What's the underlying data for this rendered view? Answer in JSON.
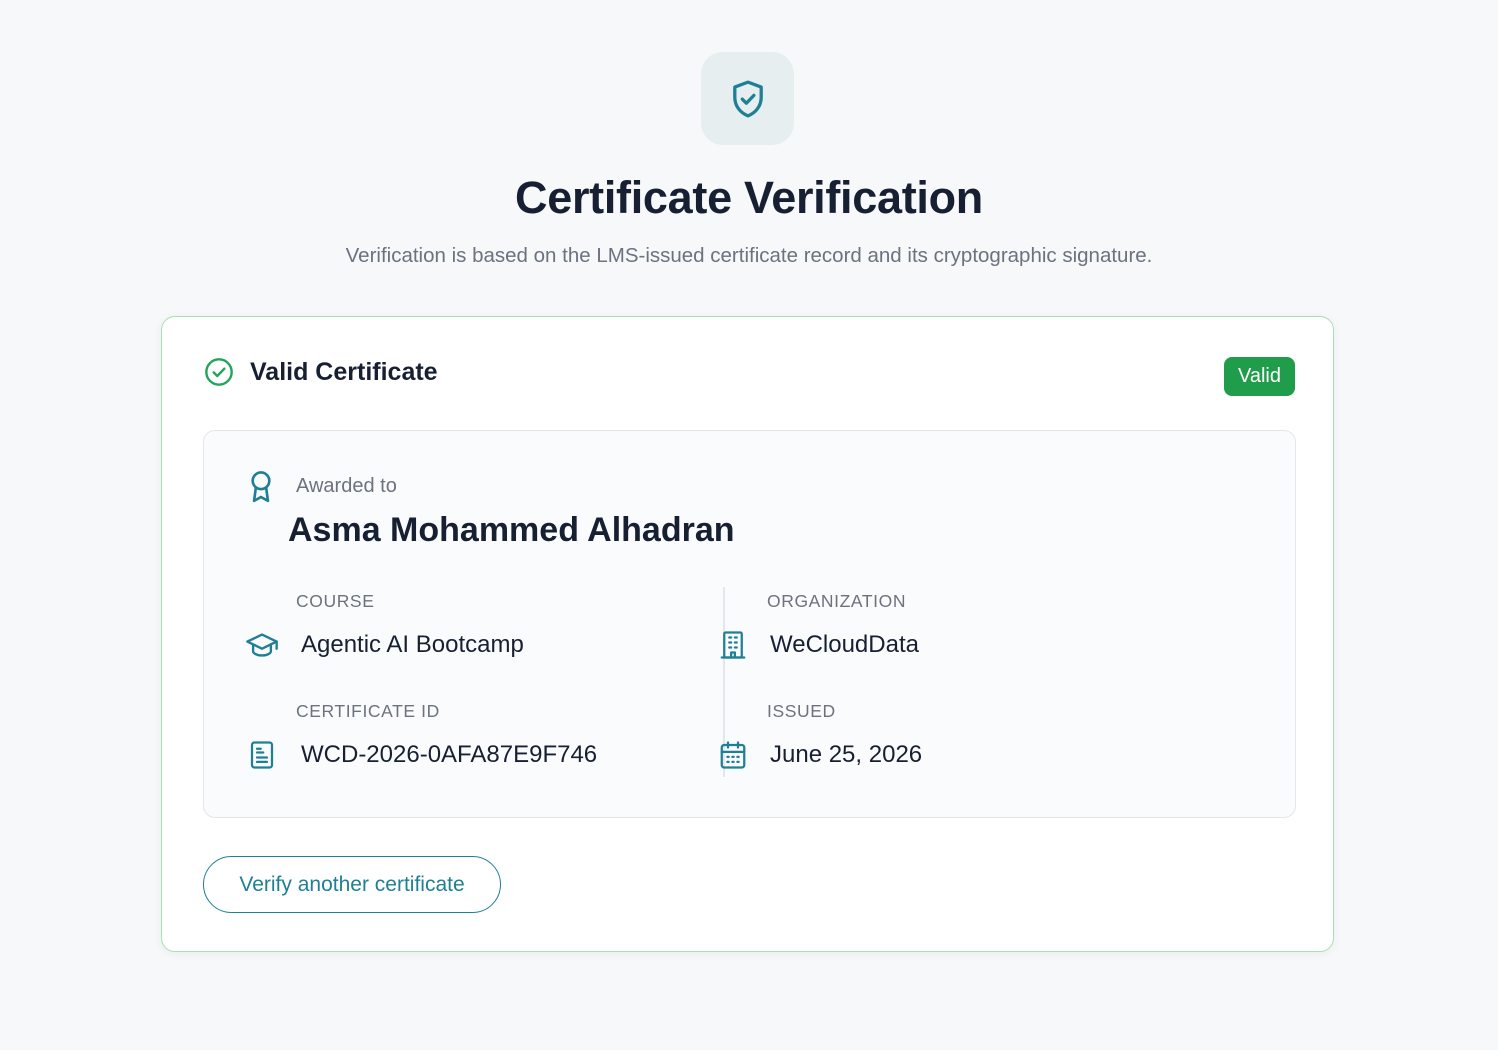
{
  "header": {
    "icon": "shield-check-icon",
    "title": "Certificate Verification",
    "subtitle": "Verification is based on the LMS-issued certificate record and its cryptographic signature."
  },
  "result": {
    "status_icon": "check-circle-icon",
    "status_title": "Valid Certificate",
    "badge": "Valid"
  },
  "certificate": {
    "awarded_icon": "award-ribbon-icon",
    "awarded_label": "Awarded to",
    "recipient": "Asma Mohammed Alhadran",
    "course": {
      "label": "COURSE",
      "value": "Agentic AI Bootcamp",
      "icon": "graduation-cap-icon"
    },
    "organization": {
      "label": "ORGANIZATION",
      "value": "WeCloudData",
      "icon": "building-icon"
    },
    "certificate_id": {
      "label": "CERTIFICATE ID",
      "value": "WCD-2026-0AFA87E9F746",
      "icon": "document-icon"
    },
    "issued": {
      "label": "ISSUED",
      "value": "June 25, 2026",
      "icon": "calendar-icon"
    }
  },
  "actions": {
    "verify_another": "Verify another certificate"
  },
  "colors": {
    "accent": "#1f7f95",
    "success": "#1f9d4a",
    "card_border": "#a7e0b6"
  }
}
